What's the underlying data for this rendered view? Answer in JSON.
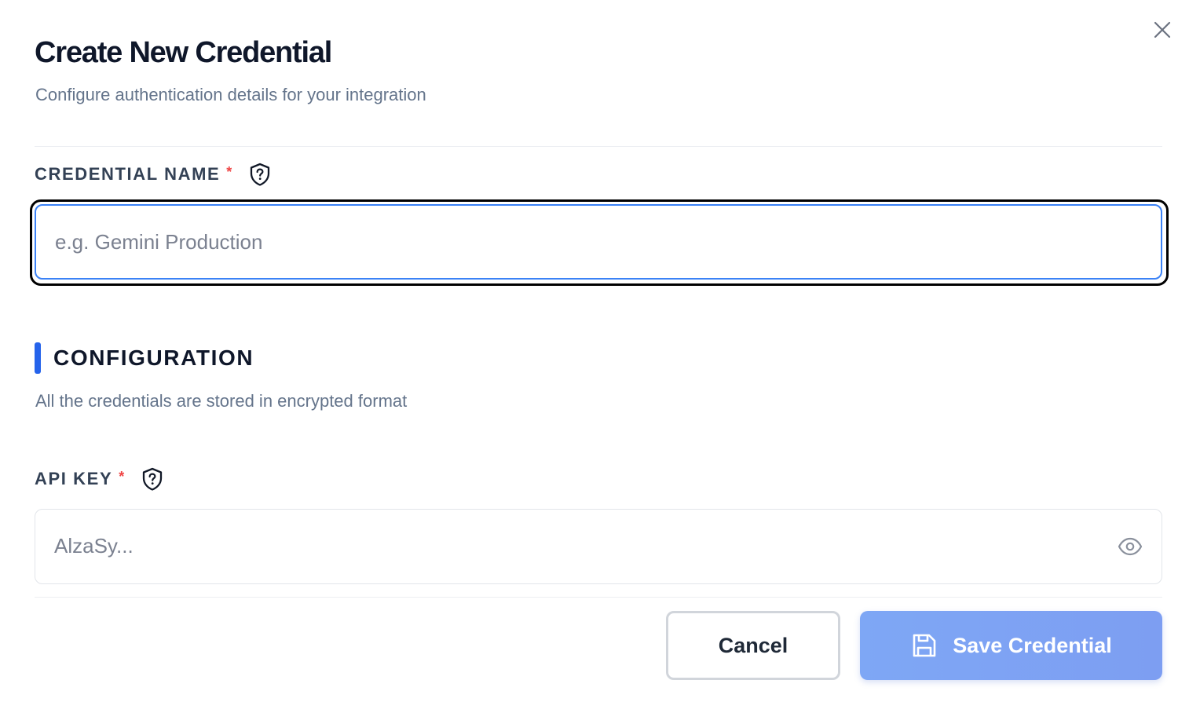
{
  "dialog": {
    "title": "Create New Credential",
    "subtitle": "Configure authentication details for your integration",
    "close_icon": "close-icon"
  },
  "credential_name": {
    "label": "CREDENTIAL NAME",
    "required_mark": "*",
    "help_icon": "shield-question-icon",
    "value": "",
    "placeholder": "e.g. Gemini Production",
    "focused": true
  },
  "configuration": {
    "title": "CONFIGURATION",
    "description": "All the credentials are stored in encrypted format"
  },
  "api_key": {
    "label": "API KEY",
    "required_mark": "*",
    "help_icon": "shield-question-icon",
    "value": "",
    "placeholder": "AlzaSy...",
    "toggle_icon": "eye-icon"
  },
  "actions": {
    "cancel_label": "Cancel",
    "save_label": "Save Credential",
    "save_icon": "save-icon"
  },
  "colors": {
    "accent": "#2563eb",
    "focus_border": "#3b82f6",
    "required": "#ef4444",
    "save_button": "#7ea7f5"
  }
}
